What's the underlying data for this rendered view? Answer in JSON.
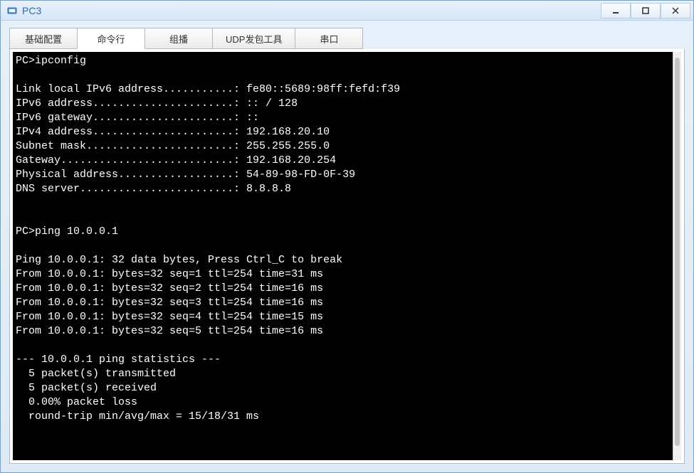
{
  "window": {
    "title": "PC3"
  },
  "tabs": [
    {
      "label": "基础配置",
      "active": false
    },
    {
      "label": "命令行",
      "active": true
    },
    {
      "label": "组播",
      "active": false
    },
    {
      "label": "UDP发包工具",
      "active": false
    },
    {
      "label": "串口",
      "active": false
    }
  ],
  "terminal": {
    "prompt": "PC>",
    "cmd_ipconfig": "ipconfig",
    "blank": "",
    "ipconfig_lines": {
      "link_local": "Link local IPv6 address...........: fe80::5689:98ff:fefd:f39",
      "ipv6_addr": "IPv6 address......................: :: / 128",
      "ipv6_gw": "IPv6 gateway......................: ::",
      "ipv4_addr": "IPv4 address......................: 192.168.20.10",
      "subnet": "Subnet mask.......................: 255.255.255.0",
      "gateway": "Gateway...........................: 192.168.20.254",
      "phys": "Physical address..................: 54-89-98-FD-0F-39",
      "dns": "DNS server........................: 8.8.8.8"
    },
    "cmd_ping": "ping 10.0.0.1",
    "ping_header": "Ping 10.0.0.1: 32 data bytes, Press Ctrl_C to break",
    "ping_replies": [
      "From 10.0.0.1: bytes=32 seq=1 ttl=254 time=31 ms",
      "From 10.0.0.1: bytes=32 seq=2 ttl=254 time=16 ms",
      "From 10.0.0.1: bytes=32 seq=3 ttl=254 time=16 ms",
      "From 10.0.0.1: bytes=32 seq=4 ttl=254 time=15 ms",
      "From 10.0.0.1: bytes=32 seq=5 ttl=254 time=16 ms"
    ],
    "stats_header": "--- 10.0.0.1 ping statistics ---",
    "stats_tx": "  5 packet(s) transmitted",
    "stats_rx": "  5 packet(s) received",
    "stats_loss": "  0.00% packet loss",
    "stats_rtt": "  round-trip min/avg/max = 15/18/31 ms"
  }
}
